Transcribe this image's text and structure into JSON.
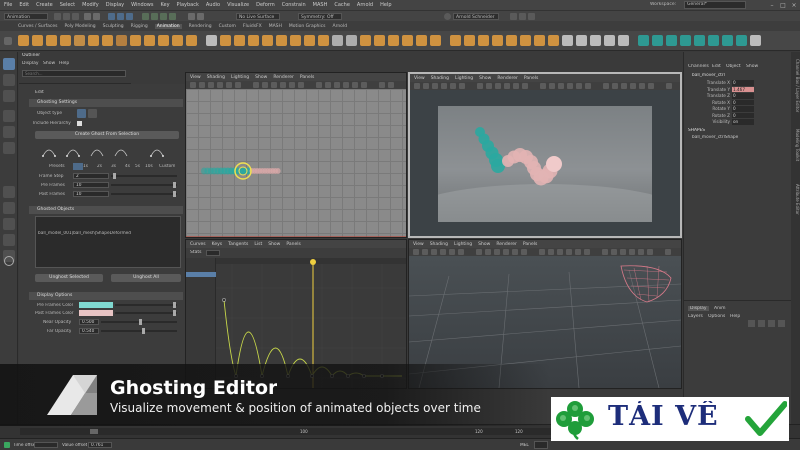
{
  "app": {
    "menus": [
      "File",
      "Edit",
      "Create",
      "Select",
      "Modify",
      "Display",
      "Windows",
      "Key",
      "Playback",
      "Audio",
      "Visualize",
      "Deform",
      "Constrain",
      "MASH",
      "Cache",
      "Arnold",
      "Help"
    ],
    "workspace_label": "Workspace:",
    "workspace_value": "General*",
    "module_menu": "Animation",
    "live_surface": "No Live Surface",
    "symmetry": "Symmetry: Off",
    "user_name": "Arnold Schneider",
    "colors": {
      "accent": "#f1a24a",
      "teal": "#2aa8a0",
      "bg": "#3a3a3a"
    }
  },
  "shelf": {
    "tabs": [
      "Curves / Surfaces",
      "Poly Modeling",
      "Sculpting",
      "Rigging",
      "Animation",
      "Rendering",
      "Custom",
      "FluidsFX",
      "MASH",
      "Motion Graphics",
      "Arnold"
    ],
    "active_tab": "Animation"
  },
  "outliner": {
    "title": "Outliner",
    "menu": [
      "Display",
      "Show",
      "Help"
    ],
    "search_placeholder": "Search..."
  },
  "ghosting_editor": {
    "menu": [
      "Edit"
    ],
    "settings_header": "Ghosting Settings",
    "object_type_label": "Object type",
    "include_hierarchy_label": "Include Hierarchy",
    "create_button": "Create Ghost From Selection",
    "presets_label": "Presets",
    "preset_options": [
      "1s",
      "2s",
      "3s",
      "4s",
      "5s",
      "10s",
      "Custom"
    ],
    "frame_step_label": "Frame Step",
    "frame_step_value": "2",
    "pre_frames_label": "Pre Frames",
    "pre_frames_value": "10",
    "post_frames_label": "Post Frames",
    "post_frames_value": "10",
    "ghosted_objects_header": "Ghosted Objects",
    "ghosted_object_item": "ball_model_001|ball_mesh|ShapeDeformed",
    "unghost_selected_button": "Unghost Selected",
    "unghost_all_button": "Unghost All",
    "display_options_header": "Display Options",
    "pre_frames_color_label": "Pre Frames Color",
    "post_frames_color_label": "Post Frames Color",
    "near_opacity_label": "Near Opacity",
    "near_opacity_value": "0.500",
    "far_opacity_label": "Far Opacity",
    "far_opacity_value": "0.540",
    "pre_color": "#7fd8d0",
    "post_color": "#e8c4c4"
  },
  "viewports": {
    "panel_menu": [
      "View",
      "Shading",
      "Lighting",
      "Show",
      "Renderer",
      "Panels"
    ],
    "graph_menu": [
      "Curves",
      "Keys",
      "Tangents",
      "List",
      "Show",
      "Panels"
    ],
    "graph_stats_label": "Stats"
  },
  "channel_box": {
    "tabs": [
      "Channels",
      "Edit",
      "Object",
      "Show"
    ],
    "object_name": "ball_mover_ctrl",
    "attributes": [
      {
        "name": "Translate X",
        "value": "0"
      },
      {
        "name": "Translate Y",
        "value": "1.467"
      },
      {
        "name": "Translate Z",
        "value": "0"
      },
      {
        "name": "Rotate X",
        "value": "0"
      },
      {
        "name": "Rotate Y",
        "value": "0"
      },
      {
        "name": "Rotate Z",
        "value": "0"
      },
      {
        "name": "Visibility",
        "value": "on"
      }
    ],
    "shapes_label": "SHAPES",
    "shape_name": "ball_mover_ctrlShape",
    "layer_tabs": [
      "Display",
      "Anim"
    ],
    "layer_menu": [
      "Layers",
      "Options",
      "Help"
    ],
    "side_tabs": [
      "Channel Box / Layer Editor",
      "Modeling Toolkit",
      "Attribute Editor"
    ]
  },
  "timeline": {
    "time_offset_label": "Time offset",
    "value_offset_label": "Value offset",
    "value_offset_value": "0.761",
    "mel_label": "MEL",
    "frames": [
      "100",
      "120",
      "120",
      "200"
    ]
  },
  "overlay": {
    "title": "Ghosting Editor",
    "subtitle": "Visualize movement & position of animated objects over time"
  },
  "watermark": {
    "text": "TẢI VỀ"
  }
}
